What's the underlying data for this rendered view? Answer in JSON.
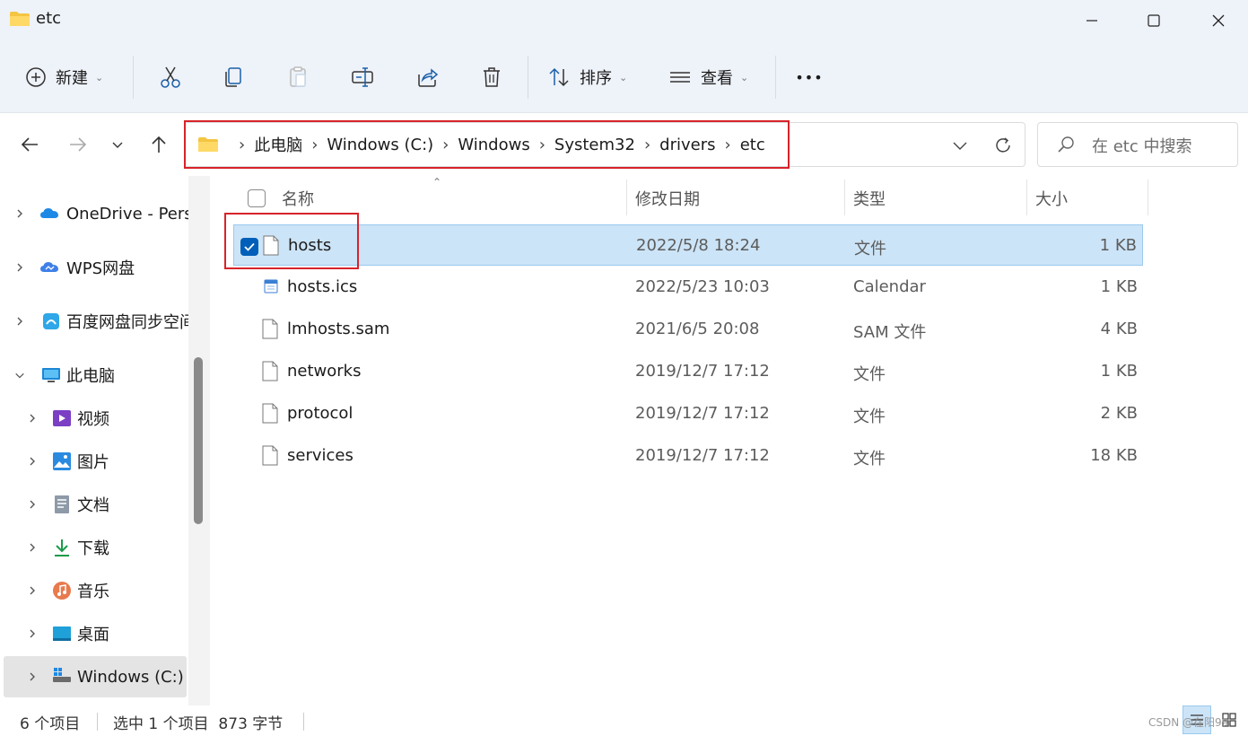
{
  "window": {
    "title": "etc"
  },
  "toolbar": {
    "new_label": "新建",
    "sort_label": "排序",
    "view_label": "查看",
    "more_label": "•••"
  },
  "address": {
    "crumbs": [
      "此电脑",
      "Windows (C:)",
      "Windows",
      "System32",
      "drivers",
      "etc"
    ]
  },
  "search": {
    "placeholder": "在 etc 中搜索"
  },
  "sidebar": {
    "items": [
      {
        "label": "OneDrive - Pers",
        "icon": "onedrive-icon",
        "expanded": false
      },
      {
        "label": "WPS网盘",
        "icon": "wps-cloud-icon",
        "expanded": false
      },
      {
        "label": "百度网盘同步空间",
        "icon": "baidu-netdisk-icon",
        "expanded": false
      },
      {
        "label": "此电脑",
        "icon": "this-pc-icon",
        "expanded": true
      },
      {
        "label": "视频",
        "icon": "videos-icon",
        "expanded": false
      },
      {
        "label": "图片",
        "icon": "pictures-icon",
        "expanded": false
      },
      {
        "label": "文档",
        "icon": "documents-icon",
        "expanded": false
      },
      {
        "label": "下载",
        "icon": "downloads-icon",
        "expanded": false
      },
      {
        "label": "音乐",
        "icon": "music-icon",
        "expanded": false
      },
      {
        "label": "桌面",
        "icon": "desktop-icon",
        "expanded": false
      },
      {
        "label": "Windows (C:)",
        "icon": "drive-icon",
        "expanded": false,
        "active": true
      }
    ]
  },
  "columns": {
    "name": "名称",
    "modified": "修改日期",
    "type": "类型",
    "size": "大小"
  },
  "files": [
    {
      "name": "hosts",
      "modified": "2022/5/8 18:24",
      "type": "文件",
      "size": "1 KB",
      "selected": true,
      "icon": "file-icon"
    },
    {
      "name": "hosts.ics",
      "modified": "2022/5/23 10:03",
      "type": "Calendar",
      "size": "1 KB",
      "selected": false,
      "icon": "calendar-file-icon"
    },
    {
      "name": "lmhosts.sam",
      "modified": "2021/6/5 20:08",
      "type": "SAM 文件",
      "size": "4 KB",
      "selected": false,
      "icon": "file-icon"
    },
    {
      "name": "networks",
      "modified": "2019/12/7 17:12",
      "type": "文件",
      "size": "1 KB",
      "selected": false,
      "icon": "file-icon"
    },
    {
      "name": "protocol",
      "modified": "2019/12/7 17:12",
      "type": "文件",
      "size": "2 KB",
      "selected": false,
      "icon": "file-icon"
    },
    {
      "name": "services",
      "modified": "2019/12/7 17:12",
      "type": "文件",
      "size": "18 KB",
      "selected": false,
      "icon": "file-icon"
    }
  ],
  "status": {
    "count": "6 个项目",
    "selection": "选中 1 个项目  873 字节"
  },
  "watermark": "CSDN @在阳99",
  "colors": {
    "selection_bg": "#cce4f7",
    "accent": "#005fb8",
    "highlight_red": "#d8232a",
    "folder_yellow": "#f4c542"
  }
}
